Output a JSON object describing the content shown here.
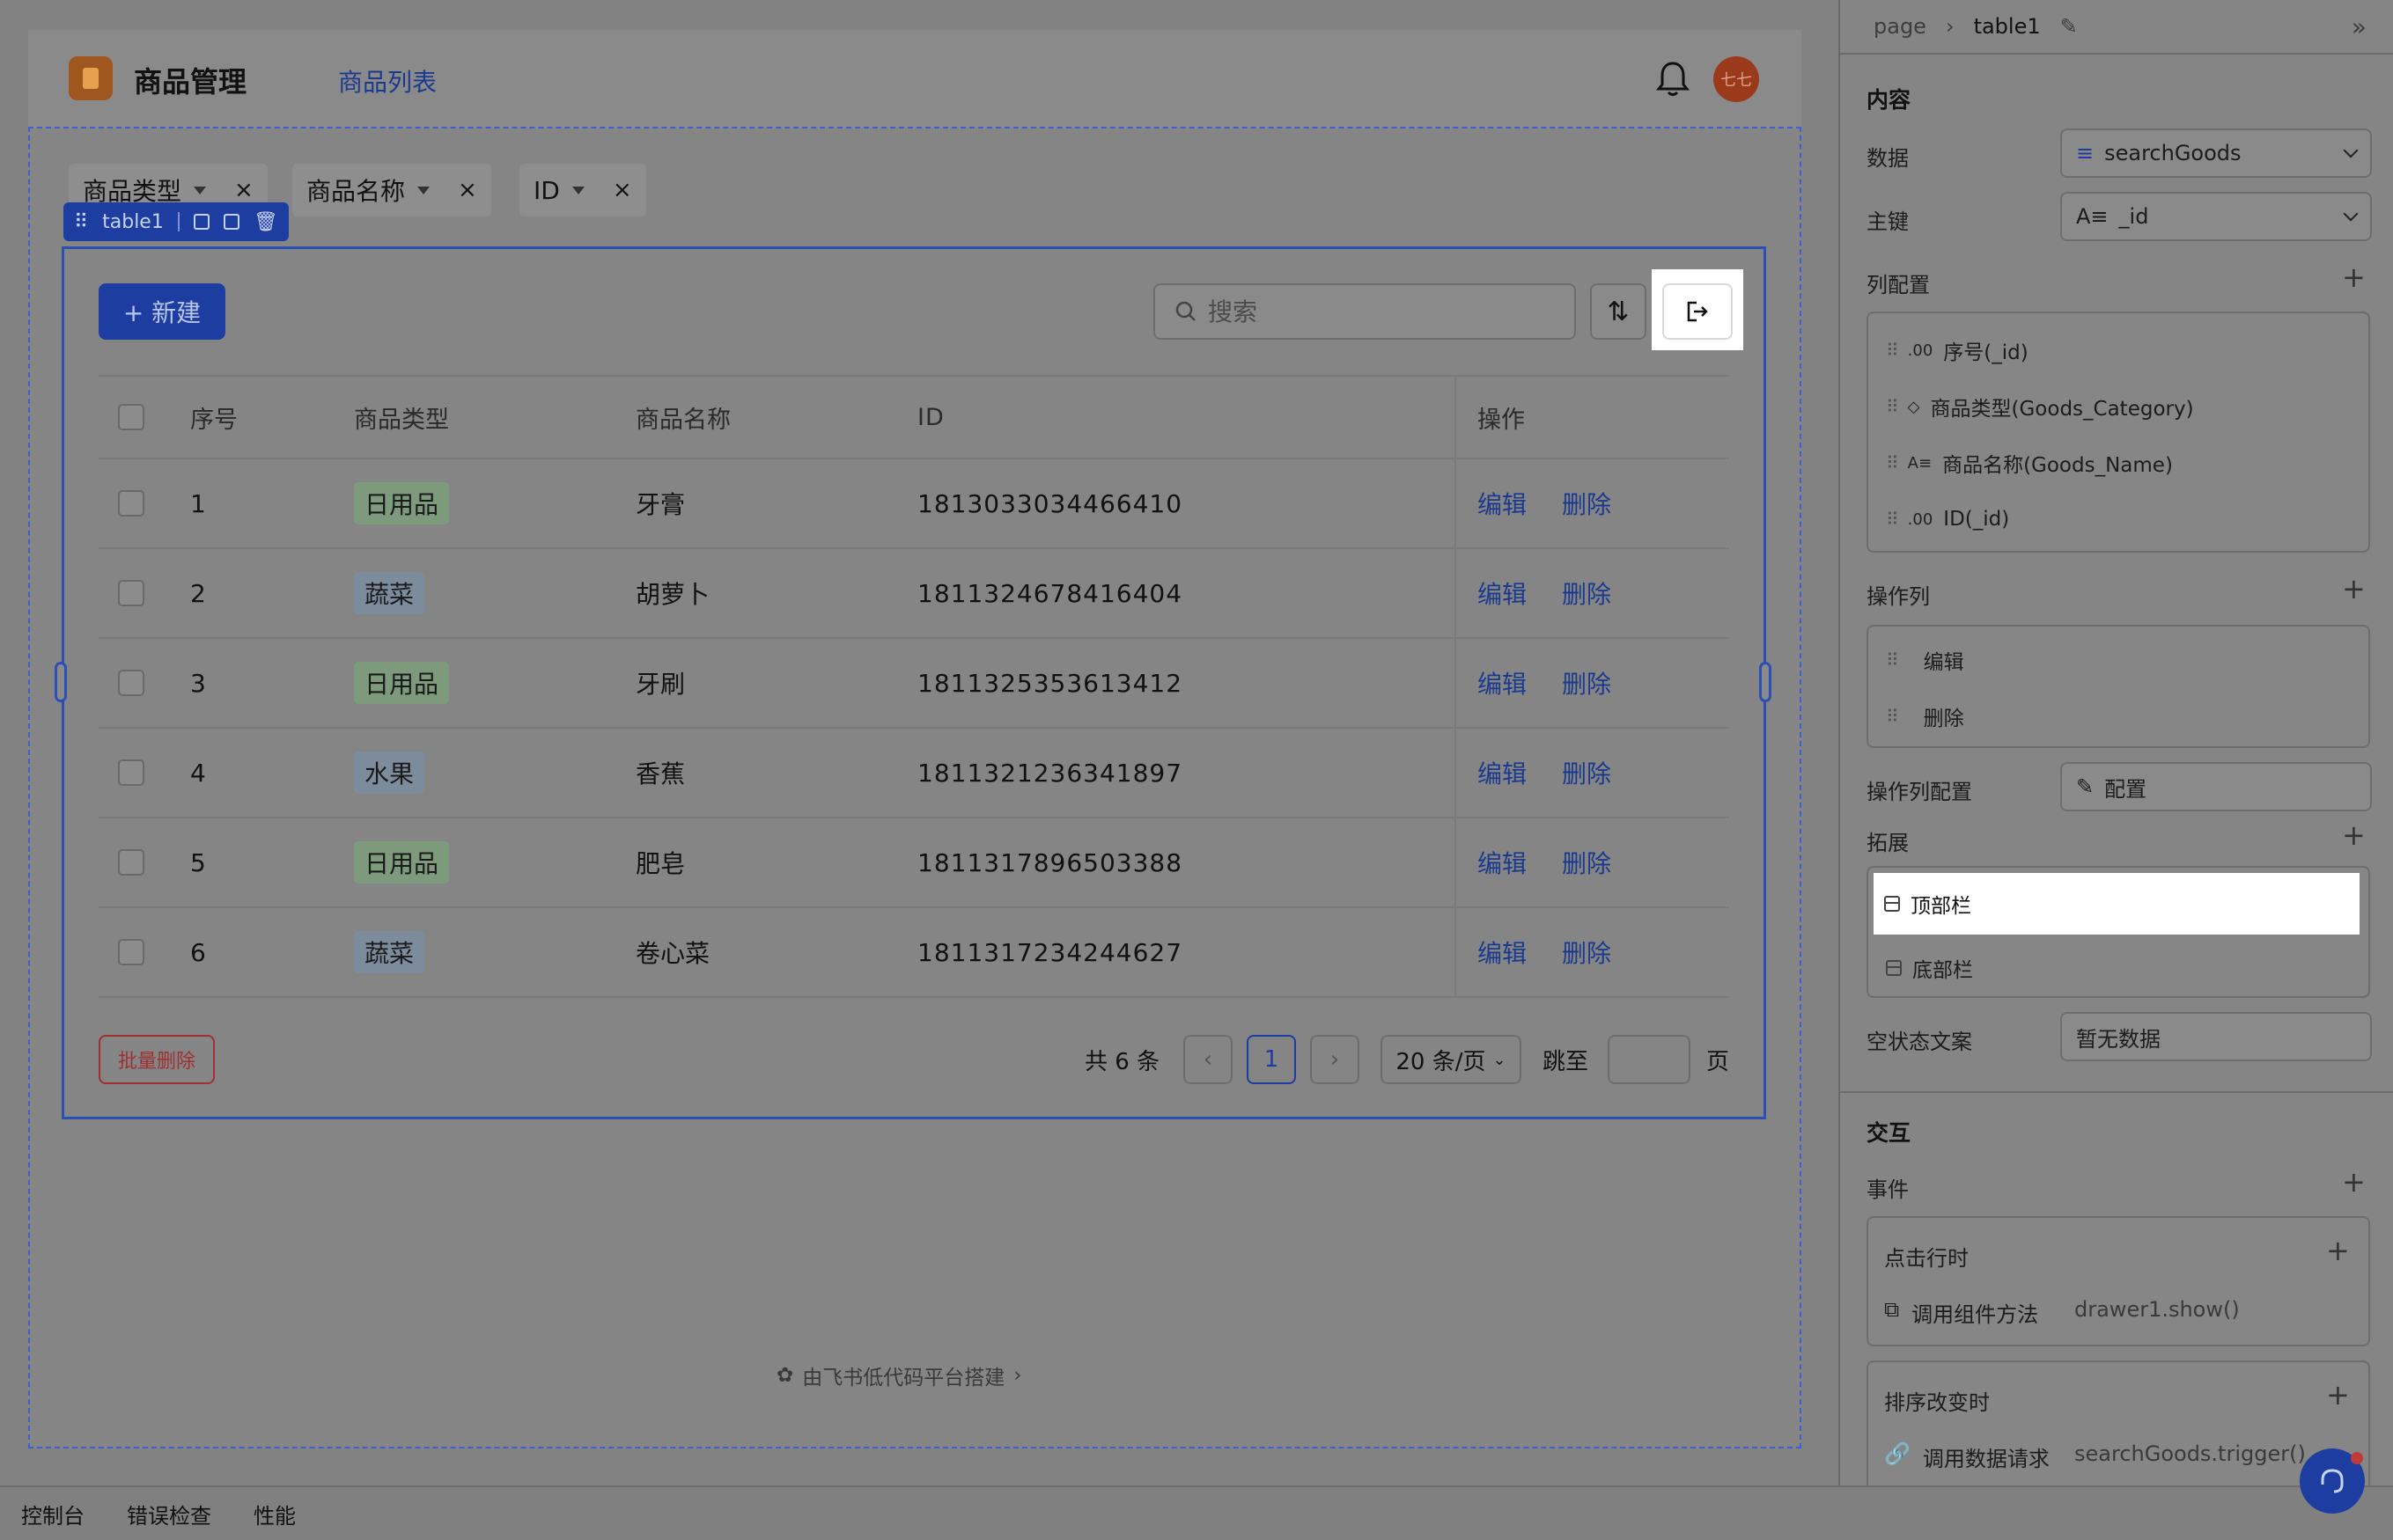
{
  "app": {
    "title": "商品管理",
    "nav_item": "商品列表",
    "avatar_text": "七七"
  },
  "filters": [
    {
      "label": "商品类型",
      "clear": "×"
    },
    {
      "label": "商品名称",
      "clear": "×"
    },
    {
      "label": "ID",
      "clear": "×"
    }
  ],
  "component_label": "table1",
  "toolbar": {
    "new_label": "+ 新建",
    "search_placeholder": "搜索"
  },
  "table": {
    "headers": [
      "序号",
      "商品类型",
      "商品名称",
      "ID",
      "操作"
    ],
    "rows": [
      {
        "seq": "1",
        "type": "日用品",
        "type_color": "green",
        "name": "牙膏",
        "id": "1813033034466410"
      },
      {
        "seq": "2",
        "type": "蔬菜",
        "type_color": "blue",
        "name": "胡萝卜",
        "id": "1811324678416404"
      },
      {
        "seq": "3",
        "type": "日用品",
        "type_color": "green",
        "name": "牙刷",
        "id": "1811325353613412"
      },
      {
        "seq": "4",
        "type": "水果",
        "type_color": "blue",
        "name": "香蕉",
        "id": "1811321236341897"
      },
      {
        "seq": "5",
        "type": "日用品",
        "type_color": "green",
        "name": "肥皂",
        "id": "1811317896503388"
      },
      {
        "seq": "6",
        "type": "蔬菜",
        "type_color": "blue",
        "name": "卷心菜",
        "id": "1811317234244627"
      }
    ],
    "edit_label": "编辑",
    "delete_label": "删除"
  },
  "footer": {
    "batch_delete": "批量删除",
    "total": "共 6 条",
    "current_page": "1",
    "page_size": "20 条/页",
    "jump_label": "跳至",
    "page_unit": "页",
    "prev": "‹",
    "next": "›"
  },
  "powered_by": "由飞书低代码平台搭建",
  "bottom_tabs": [
    "控制台",
    "错误检查",
    "性能"
  ],
  "panel": {
    "breadcrumb_root": "page",
    "breadcrumb_current": "table1",
    "section_content": "内容",
    "data_label": "数据",
    "data_value": "searchGoods",
    "key_label": "主键",
    "key_value": "_id",
    "columns_label": "列配置",
    "columns": [
      {
        "icon": ".00",
        "label": "序号(_id)"
      },
      {
        "icon": "◇",
        "label": "商品类型(Goods_Category)"
      },
      {
        "icon": "A≡",
        "label": "商品名称(Goods_Name)"
      },
      {
        "icon": ".00",
        "label": "ID(_id)"
      }
    ],
    "action_cols_label": "操作列",
    "action_cols": [
      "编辑",
      "删除"
    ],
    "action_config_label": "操作列配置",
    "action_config_btn": "配置",
    "extend_label": "拓展",
    "extend_items": [
      "顶部栏",
      "底部栏"
    ],
    "empty_label": "空状态文案",
    "empty_value": "暂无数据",
    "section_interaction": "交互",
    "events_label": "事件",
    "event1_title": "点击行时",
    "event1_action": "调用组件方法",
    "event1_value": "drawer1.show()",
    "event2_title": "排序改变时",
    "event2_action": "调用数据请求",
    "event2_value": "searchGoods.trigger()"
  },
  "colors": {
    "accent": "#1d3ea0",
    "danger": "#a03030"
  }
}
